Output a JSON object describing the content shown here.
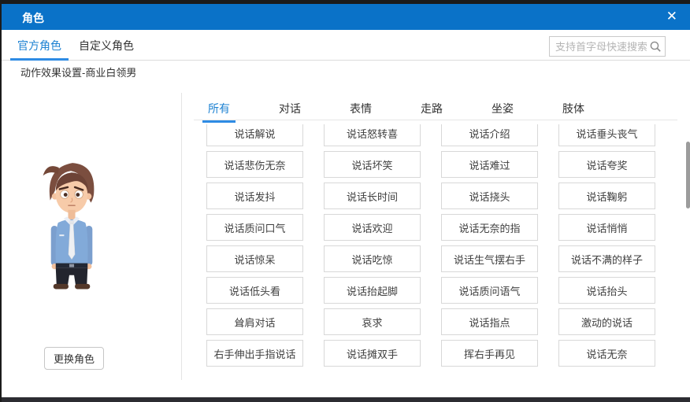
{
  "window": {
    "title": "角色",
    "close_label": "✕"
  },
  "tabs": [
    {
      "label": "官方角色",
      "active": true
    },
    {
      "label": "自定义角色",
      "active": false
    }
  ],
  "search": {
    "placeholder": "支持首字母快速搜索"
  },
  "settings_title": "动作效果设置-商业白领男",
  "character_panel": {
    "change_button_label": "更换角色"
  },
  "filter_tabs": [
    {
      "label": "所有",
      "active": true
    },
    {
      "label": "对话",
      "active": false
    },
    {
      "label": "表情",
      "active": false
    },
    {
      "label": "走路",
      "active": false
    },
    {
      "label": "坐姿",
      "active": false
    },
    {
      "label": "肢体",
      "active": false
    }
  ],
  "actions": [
    "说话解说",
    "说话怒转喜",
    "说话介绍",
    "说话垂头丧气",
    "说话悲伤无奈",
    "说话坏笑",
    "说话难过",
    "说话夸奖",
    "说话发抖",
    "说话长时间",
    "说话挠头",
    "说话鞠躬",
    "说话质问口气",
    "说话欢迎",
    "说话无奈的指",
    "说话悄悄",
    "说话惊呆",
    "说话吃惊",
    "说话生气摆右手",
    "说话不满的样子",
    "说话低头看",
    "说话抬起脚",
    "说话质问语气",
    "说话抬头",
    "耸肩对话",
    "哀求",
    "说话指点",
    "激动的说话",
    "右手伸出手指说话",
    "说话摊双手",
    "挥右手再见",
    "说话无奈"
  ],
  "colors": {
    "header_bg": "#0a72c8",
    "accent": "#1e82d2",
    "accent_underline": "#2e8be4"
  }
}
